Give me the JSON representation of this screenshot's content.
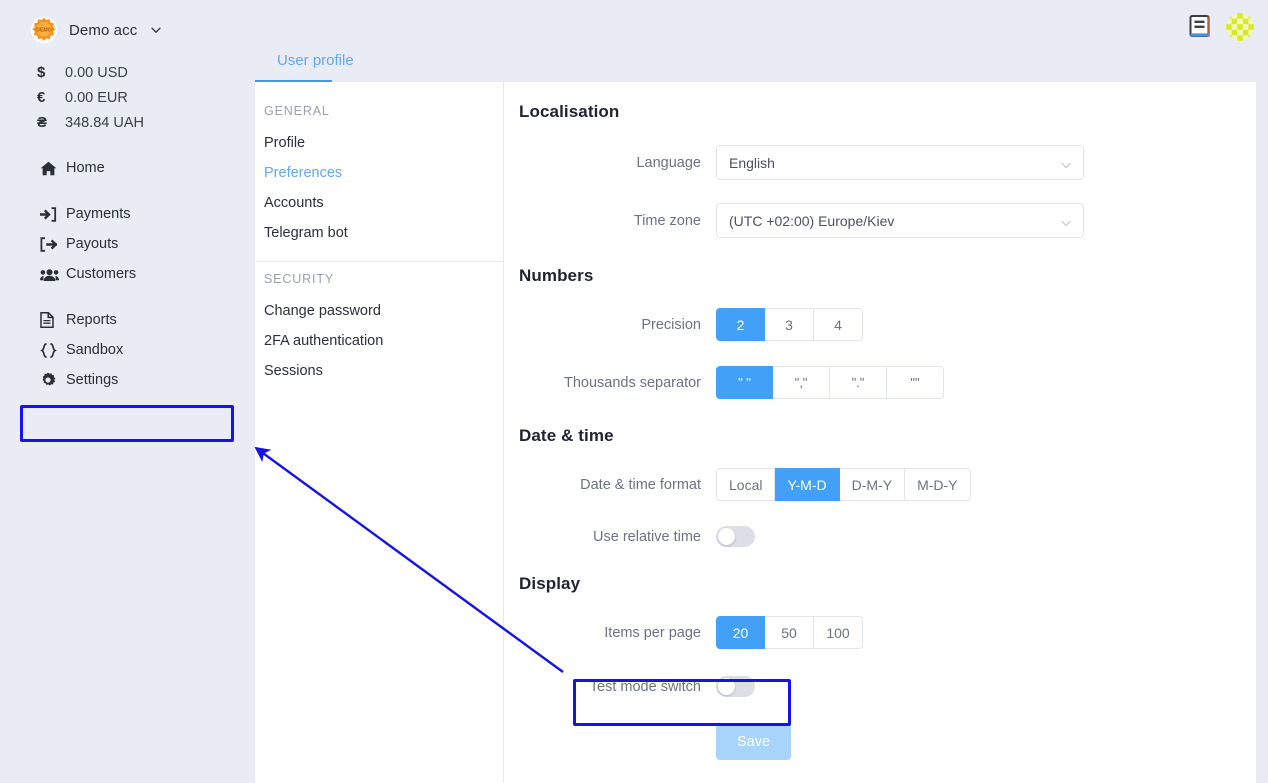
{
  "account": {
    "badge_text": "DEMO",
    "name": "Demo acc",
    "chevron_icon": "chevron-down-icon"
  },
  "balances": [
    {
      "symbol": "$",
      "value": "0.00 USD",
      "icon": "dollar-sign-icon"
    },
    {
      "symbol": "€",
      "value": "0.00 EUR",
      "icon": "euro-sign-icon"
    },
    {
      "symbol": "₴",
      "value": "348.84 UAH",
      "icon": "hryvnia-sign-icon"
    }
  ],
  "sidebar": {
    "groups": [
      {
        "items": [
          {
            "label": "Home",
            "icon": "home-icon"
          }
        ]
      },
      {
        "items": [
          {
            "label": "Payments",
            "icon": "sign-in-arrow-icon"
          },
          {
            "label": "Payouts",
            "icon": "sign-out-arrow-icon"
          },
          {
            "label": "Customers",
            "icon": "users-icon"
          }
        ]
      },
      {
        "items": [
          {
            "label": "Reports",
            "icon": "document-icon"
          },
          {
            "label": "Sandbox",
            "icon": "code-braces-icon"
          },
          {
            "label": "Settings",
            "icon": "gear-icon"
          }
        ]
      }
    ]
  },
  "topbar": {
    "tab_label": "User profile",
    "docs_icon": "book-icon",
    "avatar_icon": "avatar-identicon"
  },
  "submenu": {
    "general_heading": "GENERAL",
    "general_items": [
      {
        "label": "Profile",
        "active": false
      },
      {
        "label": "Preferences",
        "active": true
      },
      {
        "label": "Accounts",
        "active": false
      },
      {
        "label": "Telegram bot",
        "active": false
      }
    ],
    "security_heading": "SECURITY",
    "security_items": [
      {
        "label": "Change password",
        "active": false
      },
      {
        "label": "2FA authentication",
        "active": false
      },
      {
        "label": "Sessions",
        "active": false
      }
    ]
  },
  "sections": {
    "localisation": {
      "title": "Localisation",
      "language": {
        "label": "Language",
        "value": "English"
      },
      "timezone": {
        "label": "Time zone",
        "value": "(UTC +02:00) Europe/Kiev"
      }
    },
    "numbers": {
      "title": "Numbers",
      "precision": {
        "label": "Precision",
        "options": [
          "2",
          "3",
          "4"
        ],
        "selected_index": 0
      },
      "thousands_separator": {
        "label": "Thousands separator",
        "options": [
          "\" \"",
          "\",\"",
          "\".\"",
          "\"\""
        ],
        "selected_index": 0
      }
    },
    "datetime": {
      "title": "Date & time",
      "format": {
        "label": "Date & time format",
        "options": [
          "Local",
          "Y-M-D",
          "D-M-Y",
          "M-D-Y"
        ],
        "selected_index": 1
      },
      "relative_time": {
        "label": "Use relative time",
        "on": false
      }
    },
    "display": {
      "title": "Display",
      "items_per_page": {
        "label": "Items per page",
        "options": [
          "20",
          "50",
          "100"
        ],
        "selected_index": 0
      },
      "test_mode": {
        "label": "Test mode switch",
        "on": false
      }
    },
    "save_label": "Save"
  },
  "colors": {
    "accent_blue": "#42a0f7",
    "tab_blue": "#64a6ef",
    "sidebar_bg": "#e9ebf5",
    "annotation_blue": "#1414e8",
    "save_disabled": "#a8d4fb",
    "badge_orange": "#f59220"
  }
}
